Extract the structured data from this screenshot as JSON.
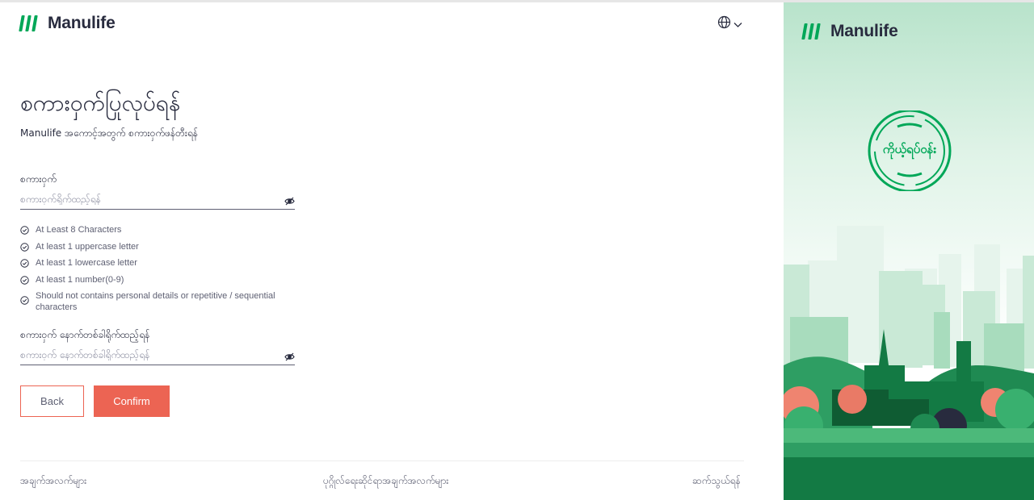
{
  "brand": {
    "name": "Manulife",
    "accent": "#00a758",
    "cta": "#ec6453"
  },
  "header": {
    "language_icon": "globe-icon"
  },
  "page": {
    "title": "စကားဝှက်ပြုလုပ်ရန်",
    "subtitle": "Manulife အကောင့်အတွက် စကားဝှက်ဖန်တီးရန်"
  },
  "password": {
    "label": "စကားဝှက်",
    "placeholder": "စကားဝှက်ရိုက်ထည့်ရန်"
  },
  "rules": [
    "At Least 8 Characters",
    "At least 1 uppercase letter",
    "At least 1 lowercase letter",
    "At least 1 number(0-9)",
    "Should not contains personal details or repetitive / sequential characters"
  ],
  "confirm_password": {
    "label": "စကားဝှက် နောက်တစ်ခါရိုက်ထည့်ရန်",
    "placeholder": "စကားဝှက် နောက်တစ်ခါရိုက်ထည့်ရန်"
  },
  "buttons": {
    "back": "Back",
    "confirm": "Confirm"
  },
  "footer": {
    "terms": "အချက်အလက်များ",
    "privacy": "ပုဂ္ဂိုလ်ရေးဆိုင်ရာအချက်အလက်များ",
    "contact": "ဆက်သွယ်ရန်"
  },
  "hero": {
    "stamp_text": "ကိုယ့်ရပ်ဝန်း"
  }
}
